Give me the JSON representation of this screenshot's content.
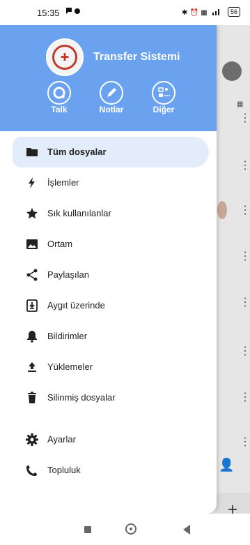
{
  "status_bar": {
    "time": "15:35",
    "left_icons": "●",
    "right_icons": "✱ ⏰ ▦ ···▌",
    "battery": "56"
  },
  "drawer": {
    "header": {
      "app_title": "Transfer Sistemi",
      "quick_actions": [
        {
          "label": "Talk",
          "icon": "talk-icon"
        },
        {
          "label": "Notlar",
          "icon": "notes-pencil-icon"
        },
        {
          "label": "Diğer",
          "icon": "more-apps-icon"
        }
      ]
    },
    "menu": [
      {
        "label": "Tüm dosyalar",
        "icon": "folder-icon",
        "active": true
      },
      {
        "label": "İşlemler",
        "icon": "lightning-icon",
        "active": false
      },
      {
        "label": "Sık kullanılanlar",
        "icon": "star-icon",
        "active": false
      },
      {
        "label": "Ortam",
        "icon": "image-icon",
        "active": false
      },
      {
        "label": "Paylaşılan",
        "icon": "share-icon",
        "active": false
      },
      {
        "label": "Aygıt üzerinde",
        "icon": "device-download-icon",
        "active": false
      },
      {
        "label": "Bildirimler",
        "icon": "bell-icon",
        "active": false
      },
      {
        "label": "Yüklemeler",
        "icon": "upload-icon",
        "active": false
      },
      {
        "label": "Silinmiş dosyalar",
        "icon": "trash-icon",
        "active": false
      },
      {
        "label": "Ayarlar",
        "icon": "gear-icon",
        "active": false
      },
      {
        "label": "Topluluk",
        "icon": "community-icon",
        "active": false
      }
    ]
  },
  "background": {
    "fab_label": "+"
  },
  "colors": {
    "header": "#6aa2f0",
    "active_item": "#e3ecfb"
  }
}
